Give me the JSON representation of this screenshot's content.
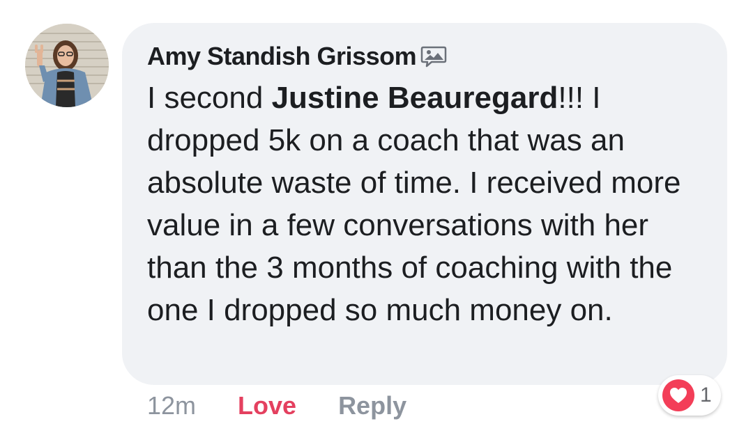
{
  "comment": {
    "author": "Amy Standish Grissom",
    "text_before": "I second ",
    "mention": "Justine Beauregard",
    "text_after": "!!! I dropped 5k on a coach that was an absolute waste of time. I received more value in a few conversations with her than the 3 months of coaching with the one I dropped so much money on."
  },
  "actions": {
    "time": "12m",
    "love": "Love",
    "reply": "Reply"
  },
  "reaction": {
    "icon": "heart-icon",
    "count": "1",
    "color": "#f33e58"
  },
  "colors": {
    "bubble": "#f0f2f5",
    "text": "#1c1e21",
    "muted": "#8d949e",
    "love": "#e4405f"
  },
  "icons": {
    "author_badge": "photo-comment-icon"
  }
}
